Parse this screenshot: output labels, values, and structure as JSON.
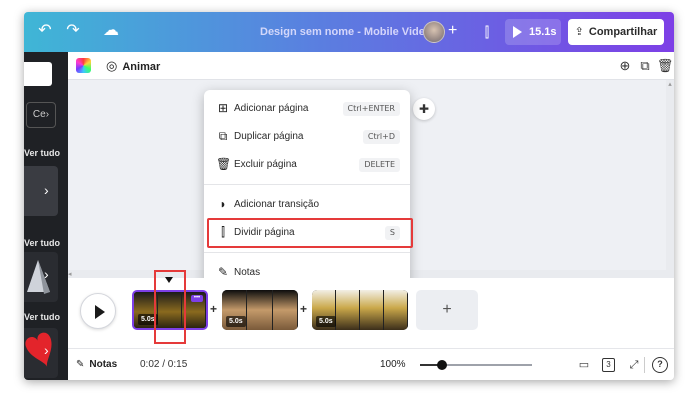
{
  "topbar": {
    "title": "Design sem nome - Mobile Video",
    "play_time": "15.1s",
    "share_label": "Compartilhar",
    "gradient_start": "#3fb6d6",
    "gradient_end": "#7d3fe6"
  },
  "leftpanel": {
    "pill_label": "Ce",
    "ver_tudo": "Ver tudo"
  },
  "subbar": {
    "animate_label": "Animar"
  },
  "context_menu": {
    "items": [
      {
        "label": "Adicionar página",
        "shortcut": "Ctrl+ENTER",
        "icon": "add-page-icon"
      },
      {
        "label": "Duplicar página",
        "shortcut": "Ctrl+D",
        "icon": "duplicate-icon"
      },
      {
        "label": "Excluir página",
        "shortcut": "DELETE",
        "icon": "trash-icon"
      },
      {
        "label": "Adicionar transição",
        "shortcut": "",
        "icon": "transition-icon"
      },
      {
        "label": "Dividir página",
        "shortcut": "S",
        "icon": "split-icon"
      },
      {
        "label": "Notas",
        "shortcut": "",
        "icon": "notes-icon"
      }
    ],
    "highlighted_item": "Dividir página",
    "highlight_color": "#e53a3a"
  },
  "timeline": {
    "clips": [
      {
        "duration": "5.0s",
        "selected": true
      },
      {
        "duration": "5.0s",
        "selected": false
      },
      {
        "duration": "5.0s",
        "selected": false
      }
    ],
    "add_page": "+"
  },
  "bottombar": {
    "notes_label": "Notas",
    "timecode": "0:02 / 0:15",
    "zoom": "100%",
    "zoom_level": 0.2,
    "page_count": "3",
    "help": "?"
  }
}
